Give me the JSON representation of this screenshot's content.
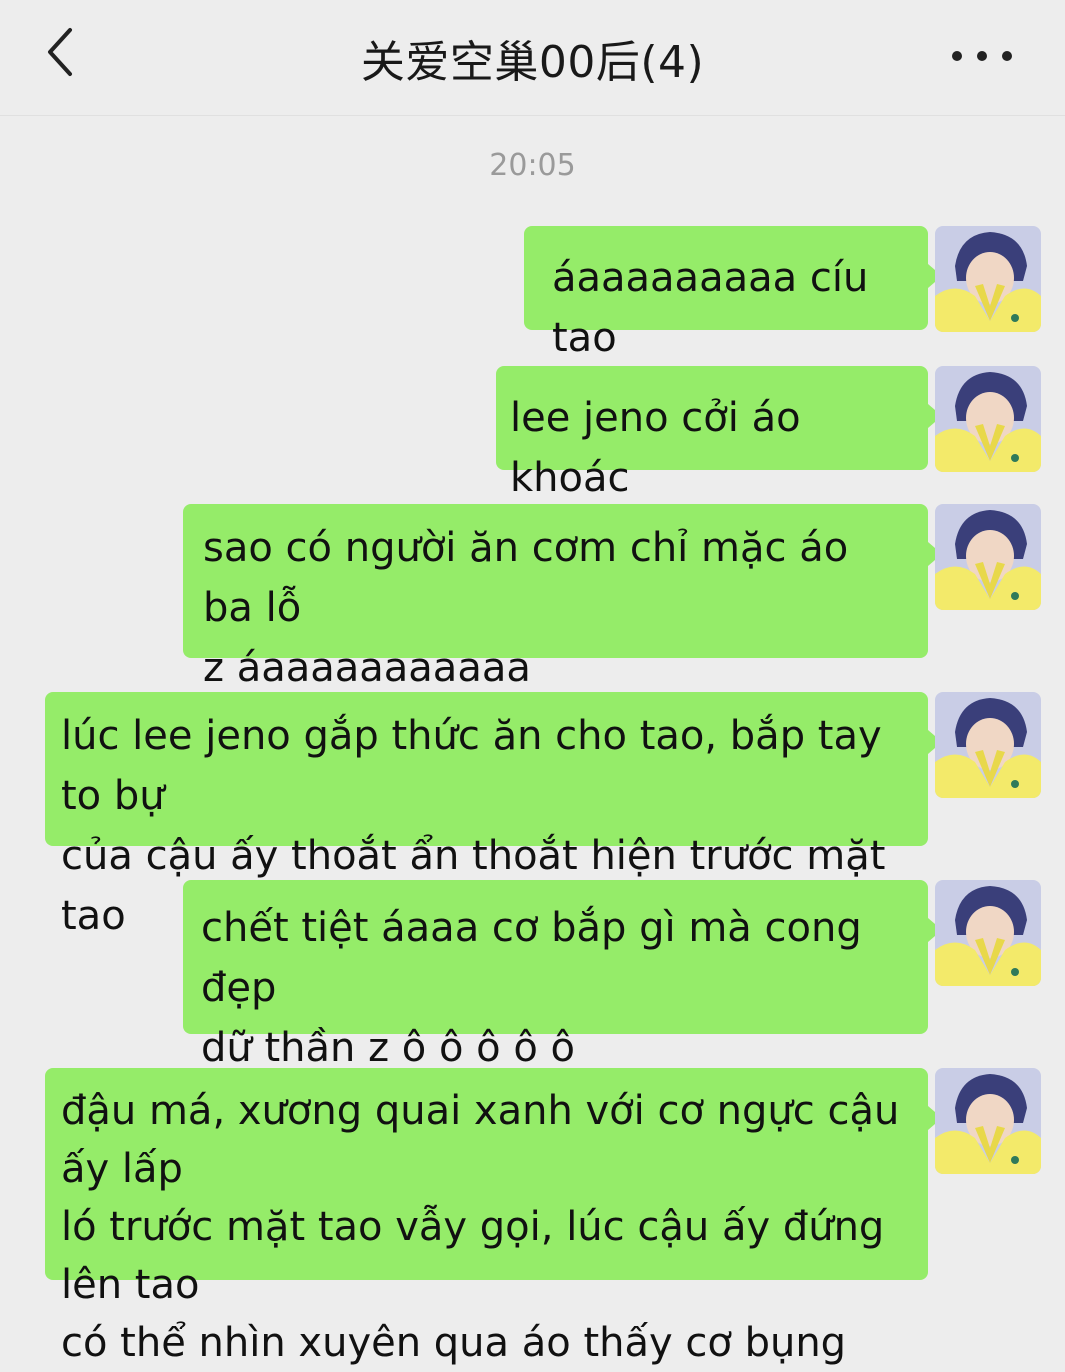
{
  "header": {
    "title": "关爱空巢00后(4)",
    "back_icon": "chevron-left-icon",
    "more_icon": "more-dots-icon"
  },
  "chat": {
    "timestamp": "20:05",
    "bubble_color": "#95ec69",
    "messages": [
      {
        "text": "áaaaaaaaaa cíu tao"
      },
      {
        "text": "lee jeno cởi áo khoác"
      },
      {
        "text": "sao có người ăn cơm chỉ mặc áo ba lỗ\nz áaaaaaaaaaaa"
      },
      {
        "text": "lúc lee jeno gắp thức ăn cho tao, bắp tay to bự\ncủa cậu ấy thoắt ẩn thoắt hiện trước mặt tao"
      },
      {
        "text": "chết tiệt áaaa cơ bắp gì mà cong đẹp\ndữ thần z ô ô ô ô ô"
      },
      {
        "text": "đậu má, xương quai xanh với cơ ngực cậu ấy lấp\nló trước mặt tao vẫy gọi, lúc cậu ấy đứng lên tao\ncó thể nhìn xuyên qua áo thấy cơ bụng"
      }
    ]
  }
}
